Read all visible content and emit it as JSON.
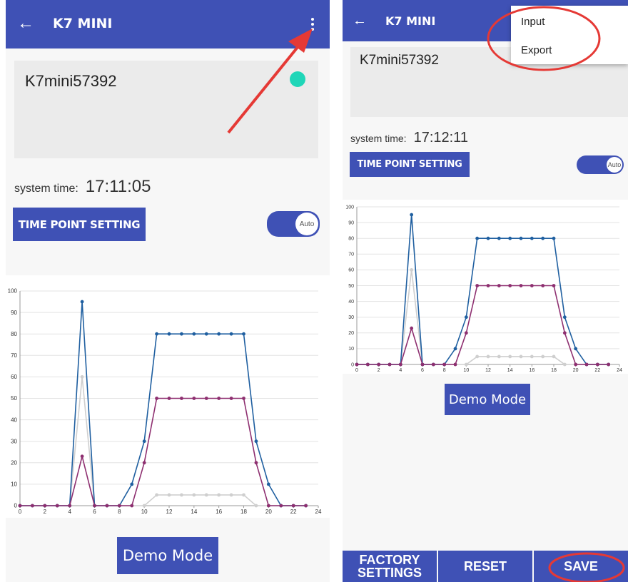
{
  "screens": [
    {
      "app_title": "K7 MINI",
      "device_name": "K7mini57392",
      "system_time_label": "system time:",
      "system_time": "17:11:05",
      "time_point_button": "TIME POINT SETTING",
      "toggle_label": "Auto",
      "demo_button": "Demo Mode"
    },
    {
      "app_title": "K7 MINI",
      "device_name": "K7mini57392",
      "system_time_label": "system time:",
      "system_time": "17:12:11",
      "time_point_button": "TIME POINT SETTING",
      "toggle_label": "Auto",
      "demo_button": "Demo Mode",
      "menu": {
        "items": [
          "Input",
          "Export"
        ]
      },
      "bottom_bar": {
        "factory": "FACTORY SETTINGS",
        "reset": "RESET",
        "save": "SAVE"
      }
    }
  ],
  "colors": {
    "accent": "#3f51b5",
    "status_dot": "#1fd6b8",
    "annotation": "#e53935"
  },
  "chart_data": {
    "type": "line",
    "x": [
      0,
      1,
      2,
      3,
      4,
      5,
      6,
      7,
      8,
      9,
      10,
      11,
      12,
      13,
      14,
      15,
      16,
      17,
      18,
      19,
      20,
      21,
      22,
      23
    ],
    "x_ticks": [
      0,
      2,
      4,
      6,
      8,
      10,
      12,
      14,
      16,
      18,
      20,
      22,
      24
    ],
    "y_ticks": [
      0,
      10,
      20,
      30,
      40,
      50,
      60,
      70,
      80,
      90,
      100
    ],
    "xlim": [
      0,
      24
    ],
    "ylim": [
      0,
      100
    ],
    "grid": true,
    "series": [
      {
        "color": "#cfcfcf",
        "values": [
          0,
          0,
          0,
          0,
          0,
          60,
          0,
          0,
          0,
          0,
          0,
          5,
          5,
          5,
          5,
          5,
          5,
          5,
          5,
          0,
          0,
          0,
          0,
          0
        ]
      },
      {
        "color": "#1f5fa0",
        "values": [
          0,
          0,
          0,
          0,
          0,
          95,
          0,
          0,
          0,
          10,
          30,
          80,
          80,
          80,
          80,
          80,
          80,
          80,
          80,
          30,
          10,
          0,
          0,
          0
        ]
      },
      {
        "color": "#8e2f70",
        "values": [
          0,
          0,
          0,
          0,
          0,
          23,
          0,
          0,
          0,
          0,
          20,
          50,
          50,
          50,
          50,
          50,
          50,
          50,
          50,
          20,
          0,
          0,
          0,
          0
        ]
      }
    ]
  }
}
